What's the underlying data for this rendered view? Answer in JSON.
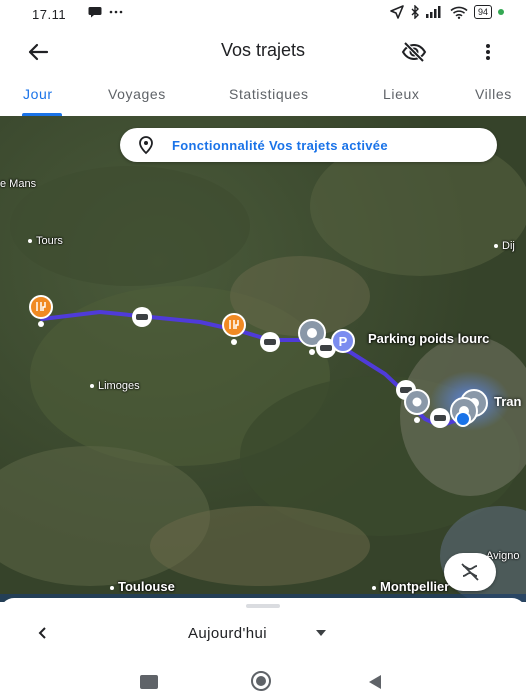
{
  "status_bar": {
    "time": "17.11",
    "battery": "94",
    "icons": [
      "chat-icon",
      "dots-icon",
      "location-arrow-icon",
      "bluetooth-icon",
      "signal-icon",
      "wifi-icon",
      "battery-icon"
    ]
  },
  "app_bar": {
    "title": "Vos trajets",
    "icons": [
      "back-arrow-icon",
      "visibility-off-icon",
      "more-vert-icon"
    ]
  },
  "tabs": [
    {
      "label": "Jour",
      "active": true
    },
    {
      "label": "Voyages",
      "active": false
    },
    {
      "label": "Statistiques",
      "active": false
    },
    {
      "label": "Lieux",
      "active": false
    },
    {
      "label": "Villes",
      "active": false
    }
  ],
  "map": {
    "banner_text": "Fonctionnalité Vos trajets activée",
    "cities": {
      "le_mans": "e Mans",
      "tours": "Tours",
      "limoges": "Limoges",
      "toulouse": "Toulouse",
      "montpellier": "Montpellier",
      "avignon": "Avigno",
      "dijon": "Dij"
    },
    "parking_label": "Parking poids lourc",
    "trans_label": "Tran",
    "route_color": "#4f3bd9",
    "restaurant_color": "#f08a24",
    "parking_color": "#7b8cf0"
  },
  "sheet": {
    "date_label": "Aujourd'hui"
  },
  "accent_color": "#1a73e8"
}
